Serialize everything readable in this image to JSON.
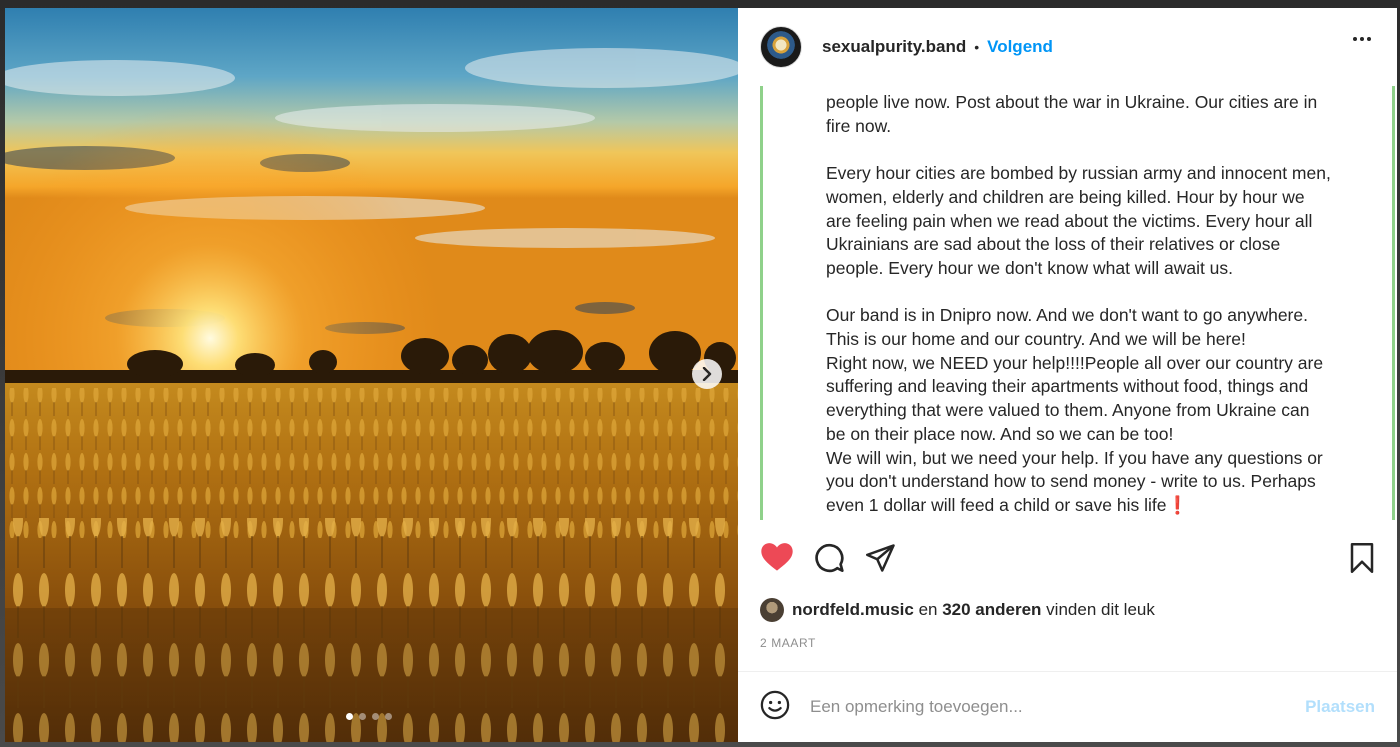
{
  "post": {
    "username": "sexualpurity.band",
    "separator": "•",
    "follow_label": "Volgend",
    "caption": "people live now. Post about the war in Ukraine. Our cities are in\nfire now.\n\nEvery hour cities are bombed by russian army and innocent men,\nwomen, elderly and children are being killed. Hour by hour we\nare feeling pain when we read about the victims. Every hour all\nUkrainians are sad about the loss of their relatives or close\npeople. Every hour we don't know what will await us.\n\nOur band is in Dnipro now. And we don't want to go anywhere.\nThis is our home and our country. And we will be here!\nRight now, we NEED your help!!!!People all over our country are\nsuffering and leaving their apartments without food, things and\neverything that were valued to them. Anyone from Ukraine can\nbe on their place now. And so we can be too!\nWe will win, but we need your help. If you have any questions or\nyou don't understand how to send money - write to us. Perhaps\neven 1 dollar will feed a child or save his life❗\nIf you want to join the campaign to help Ukraine donate, please",
    "likes": {
      "user": "nordfeld.music",
      "connector": " en ",
      "count_text": "320 anderen",
      "suffix": " vinden dit leuk"
    },
    "date": "2 MAART",
    "image_count": 4,
    "active_image": 1
  },
  "comment": {
    "placeholder": "Een opmerking toevoegen...",
    "post_label": "Plaatsen"
  },
  "icons": {
    "like": "heart-filled-icon",
    "comment": "comment-bubble-icon",
    "share": "paper-plane-icon",
    "save": "bookmark-icon",
    "emoji": "smiley-icon",
    "next": "chevron-right-icon",
    "more": "more-horizontal-icon"
  },
  "colors": {
    "accent": "#0095f6",
    "like": "#ed4956",
    "post_disabled": "#b2dffc"
  }
}
